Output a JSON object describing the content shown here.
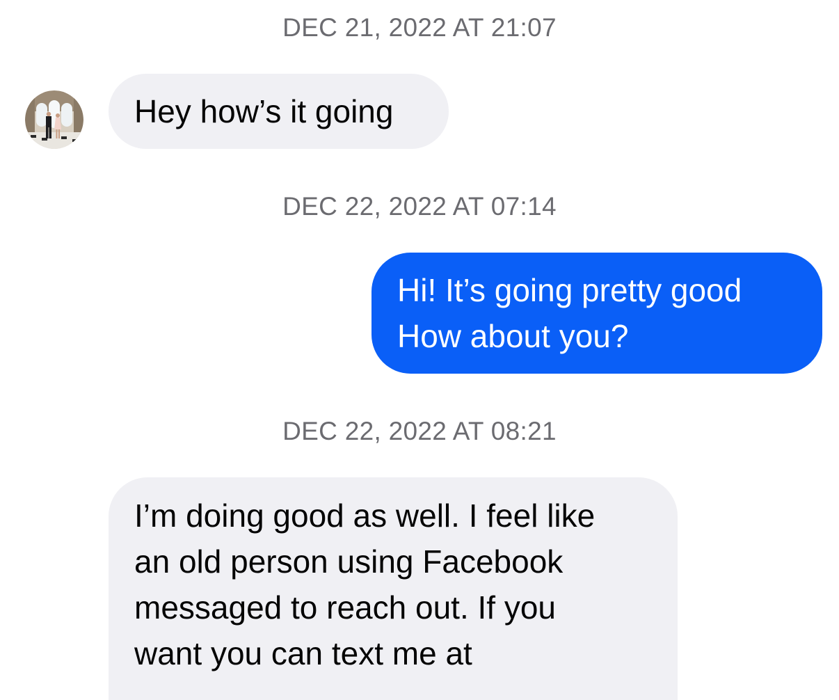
{
  "thread": {
    "timestamps": [
      "DEC 21, 2022 AT 21:07",
      "DEC 22, 2022 AT 07:14",
      "DEC 22, 2022 AT 08:21"
    ],
    "messages": [
      {
        "direction": "incoming",
        "lines": [
          "Hey how’s it going"
        ]
      },
      {
        "direction": "outgoing",
        "lines": [
          "Hi! It’s going pretty good",
          "How about you?"
        ]
      },
      {
        "direction": "incoming",
        "lines": [
          "I’m doing good as well. I feel like",
          "an old person using Facebook",
          "messaged to reach out. If you",
          "want you can text me at"
        ]
      }
    ]
  },
  "contact": {
    "avatar_icon": "contact-avatar-photo"
  },
  "colors": {
    "incoming_bubble": "#f0f0f4",
    "outgoing_bubble": "#0a5ff7",
    "timestamp_text": "#6b6b70"
  }
}
